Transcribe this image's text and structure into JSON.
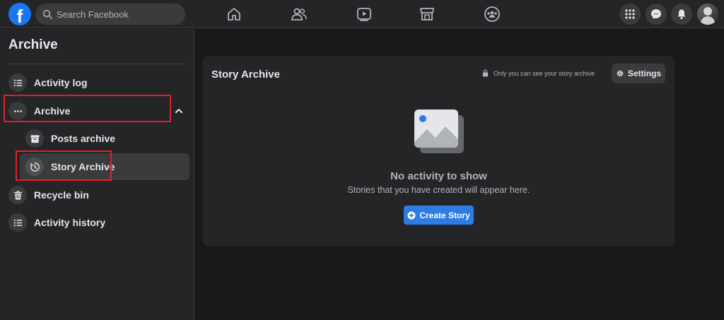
{
  "search": {
    "placeholder": "Search Facebook"
  },
  "sidebar": {
    "title": "Archive",
    "items": [
      {
        "label": "Activity log",
        "icon": "list-icon"
      },
      {
        "label": "Archive",
        "icon": "more-dots-icon"
      },
      {
        "label": "Posts archive",
        "icon": "archive-box-icon"
      },
      {
        "label": "Story Archive",
        "icon": "history-clock-icon"
      },
      {
        "label": "Recycle bin",
        "icon": "trash-icon"
      },
      {
        "label": "Activity history",
        "icon": "list-icon"
      }
    ]
  },
  "main": {
    "card_title": "Story Archive",
    "privacy_note": "Only you can see your story archive",
    "settings_label": "Settings",
    "empty_title": "No activity to show",
    "empty_subtitle": "Stories that you have created will appear here.",
    "create_label": "Create Story"
  },
  "colors": {
    "background": "#18191a",
    "surface": "#242526",
    "accent": "#1877f2",
    "highlight": "#e0202a"
  }
}
